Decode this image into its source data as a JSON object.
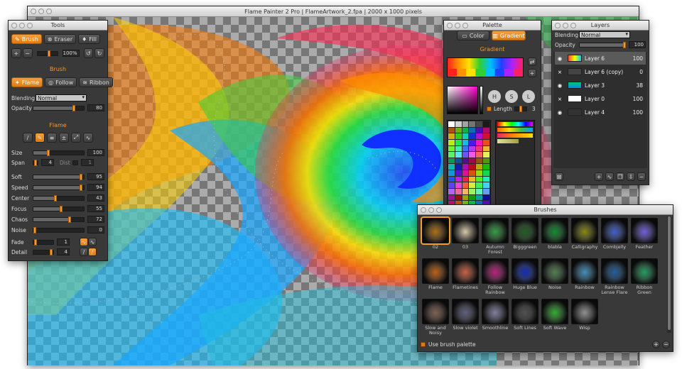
{
  "main": {
    "title": "Flame Painter 2 Pro | FlameArtwork_2.fpa | 2000 x 1000 pixels"
  },
  "tools": {
    "title": "Tools",
    "tool_buttons": [
      "Brush",
      "Eraser",
      "Fill"
    ],
    "zoom": "100%",
    "brush_section": "Brush",
    "modes": [
      "Flame",
      "Follow",
      "Ribbon"
    ],
    "blending_label": "Blending",
    "blending_value": "Normal",
    "opacity_label": "Opacity",
    "opacity": "80",
    "flame_section": "Flame",
    "size_label": "Size",
    "size": "100",
    "span_label": "Span",
    "span": "4",
    "dist_label": "Dist",
    "dist": "1",
    "params": [
      {
        "label": "Soft",
        "value": "95",
        "frac": 0.95
      },
      {
        "label": "Speed",
        "value": "94",
        "frac": 0.94
      },
      {
        "label": "Center",
        "value": "43",
        "frac": 0.43
      },
      {
        "label": "Focus",
        "value": "55",
        "frac": 0.55
      },
      {
        "label": "Chaos",
        "value": "72",
        "frac": 0.72
      },
      {
        "label": "Noise",
        "value": "0",
        "frac": 0
      }
    ],
    "fade_label": "Fade",
    "fade": "1",
    "detail_label": "Detail",
    "detail": "4"
  },
  "palette": {
    "title": "Palette",
    "tabs": [
      "Color",
      "Gradient"
    ],
    "section": "Gradient",
    "hsl": [
      "H",
      "S",
      "L"
    ],
    "length_label": "Length",
    "length": "3"
  },
  "layers": {
    "title": "Layers",
    "blending_label": "Blending",
    "blending_value": "Normal",
    "opacity_label": "Opacity",
    "opacity": "100",
    "items": [
      {
        "name": "Layer 6",
        "value": "100"
      },
      {
        "name": "Layer 6 (copy)",
        "value": "0"
      },
      {
        "name": "Layer 3",
        "value": "38"
      },
      {
        "name": "Layer 0",
        "value": "100"
      },
      {
        "name": "Layer 4",
        "value": "100"
      }
    ]
  },
  "brushes": {
    "title": "Brushes",
    "use_palette": "Use brush palette",
    "items": [
      "02",
      "03",
      "Autumn Forest",
      "Bigggreen",
      "blabla",
      "Calligraphy",
      "Combjelly",
      "Feather",
      "Flame",
      "Flametines",
      "Follow Rainbow",
      "Huge Blue",
      "Noise",
      "Rainbow",
      "Rainbow Lense Flare",
      "Ribbon Green",
      "Slow and Noisy",
      "Slow violet",
      "Smoothline",
      "Soft Lines",
      "Soft Wave",
      "Wisp"
    ]
  },
  "colors": {
    "accent": "#f39c2a",
    "panel": "#393939"
  }
}
